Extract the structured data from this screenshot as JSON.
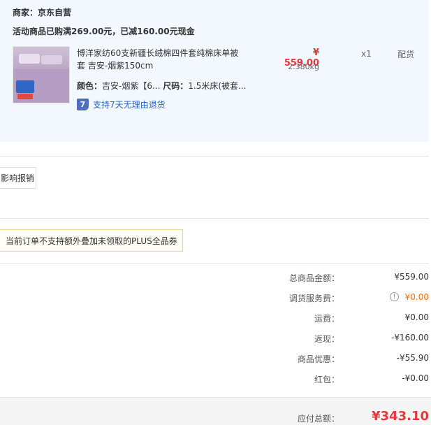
{
  "store": {
    "seller": "商家：京东自营",
    "promo": "活动商品已购满269.00元，已减160.00元现金"
  },
  "product": {
    "title": "博洋家纺60支新疆长绒棉四件套纯棉床单被套 吉安-烟紫150cm",
    "price": "¥ 559.00",
    "weight": "2.380kg",
    "quantity": "x1",
    "stock_status": "配货",
    "color_label": "颜色：",
    "color_value": "吉安-烟紫【6...",
    "size_label": "尺码：",
    "size_value": "1.5米床(被套...",
    "service_badge": "7",
    "service_text": "支持7天无理由退货"
  },
  "report_button": "影响报销",
  "coupon_note": "当前订单不支持额外叠加未领取的PLUS全品券",
  "summary": [
    {
      "label": "总商品金额：",
      "value": "¥559.00"
    },
    {
      "label": "调货服务费：",
      "value": "¥0.00",
      "icon": "info-icon",
      "color": "#ff6a00"
    },
    {
      "label": "运费：",
      "value": "¥0.00"
    },
    {
      "label": "返现：",
      "value": "-¥160.00"
    },
    {
      "label": "商品优惠：",
      "value": "-¥55.90"
    },
    {
      "label": "红包：",
      "value": "-¥0.00"
    }
  ],
  "total": {
    "label": "应付总额：",
    "value": "¥343.10"
  }
}
